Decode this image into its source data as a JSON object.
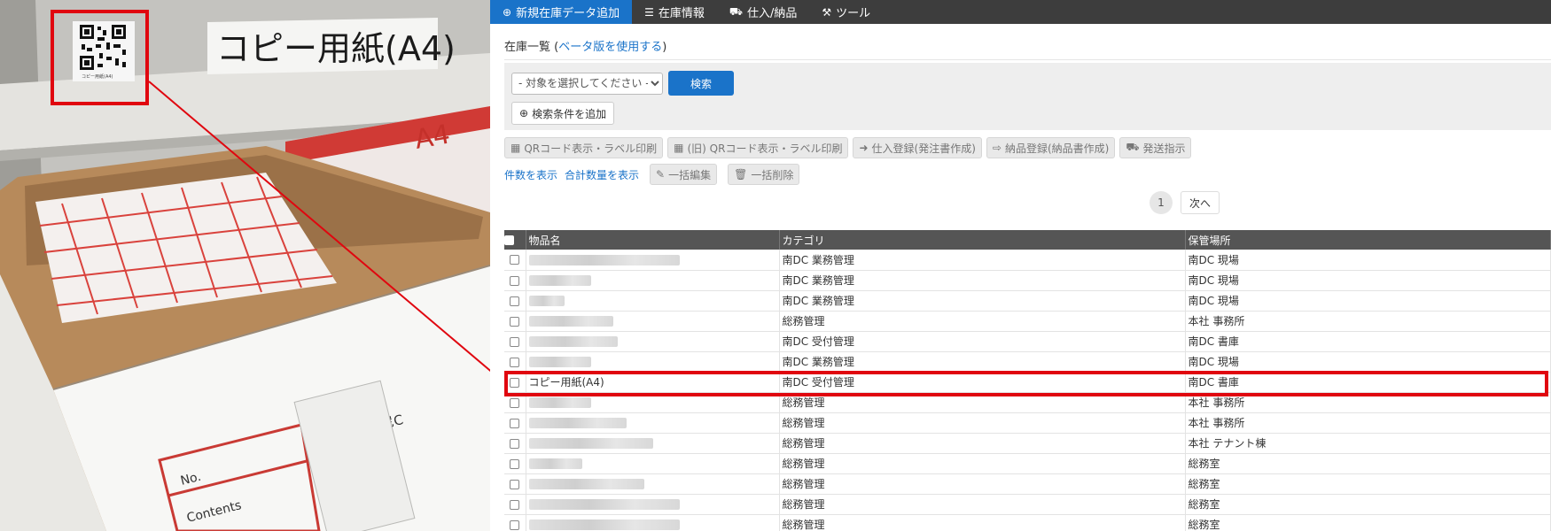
{
  "photo": {
    "shelf_label": "コピー用紙(A4)",
    "qr_caption": "コピー用紙(A4)",
    "box_text": [
      "③尼C",
      "No.",
      "Contents",
      "A4"
    ],
    "highlight_color": "#e0060f"
  },
  "nav": {
    "items": [
      {
        "label": "新規在庫データ追加",
        "icon": "plus-circle-icon",
        "active": true
      },
      {
        "label": "在庫情報",
        "icon": "list-icon",
        "active": false
      },
      {
        "label": "仕入/納品",
        "icon": "truck-loading-icon",
        "active": false
      },
      {
        "label": "ツール",
        "icon": "toolbox-icon",
        "active": false
      }
    ]
  },
  "page": {
    "title_prefix": "在庫一覧 (",
    "beta_link": "ベータ版を使用する",
    "title_suffix": ")"
  },
  "search": {
    "select_value": "- 対象を選択してください -",
    "search_button": "検索",
    "add_condition": "検索条件を追加"
  },
  "actions": {
    "qr_label": "QRコード表示・ラベル印刷",
    "old_qr_label": "(旧) QRコード表示・ラベル印刷",
    "purchase": "仕入登録(発注書作成)",
    "delivery": "納品登録(納品書作成)",
    "shipping": "発送指示"
  },
  "links": {
    "show_count": "件数を表示",
    "show_total": "合計数量を表示",
    "bulk_edit": "一括編集",
    "bulk_delete": "一括削除"
  },
  "pager": {
    "current": "1",
    "next": "次へ"
  },
  "table": {
    "headers": [
      "物品名",
      "カテゴリ",
      "保管場所"
    ],
    "rows": [
      {
        "name": "",
        "category": "南DC 業務管理",
        "location": "南DC 現場"
      },
      {
        "name": "",
        "category": "南DC 業務管理",
        "location": "南DC 現場"
      },
      {
        "name": "",
        "category": "南DC 業務管理",
        "location": "南DC 現場"
      },
      {
        "name": "",
        "category": "総務管理",
        "location": "本社 事務所"
      },
      {
        "name": "",
        "category": "南DC 受付管理",
        "location": "南DC 書庫"
      },
      {
        "name": "",
        "category": "南DC 業務管理",
        "location": "南DC 現場"
      },
      {
        "name": "コピー用紙(A4)",
        "category": "南DC 受付管理",
        "location": "南DC 書庫"
      },
      {
        "name": "",
        "category": "総務管理",
        "location": "本社 事務所"
      },
      {
        "name": "",
        "category": "総務管理",
        "location": "本社 事務所"
      },
      {
        "name": "",
        "category": "総務管理",
        "location": "本社 テナント棟"
      },
      {
        "name": "",
        "category": "総務管理",
        "location": "総務室"
      },
      {
        "name": "",
        "category": "総務管理",
        "location": "総務室"
      },
      {
        "name": "",
        "category": "総務管理",
        "location": "総務室"
      },
      {
        "name": "",
        "category": "総務管理",
        "location": "総務室"
      }
    ]
  }
}
